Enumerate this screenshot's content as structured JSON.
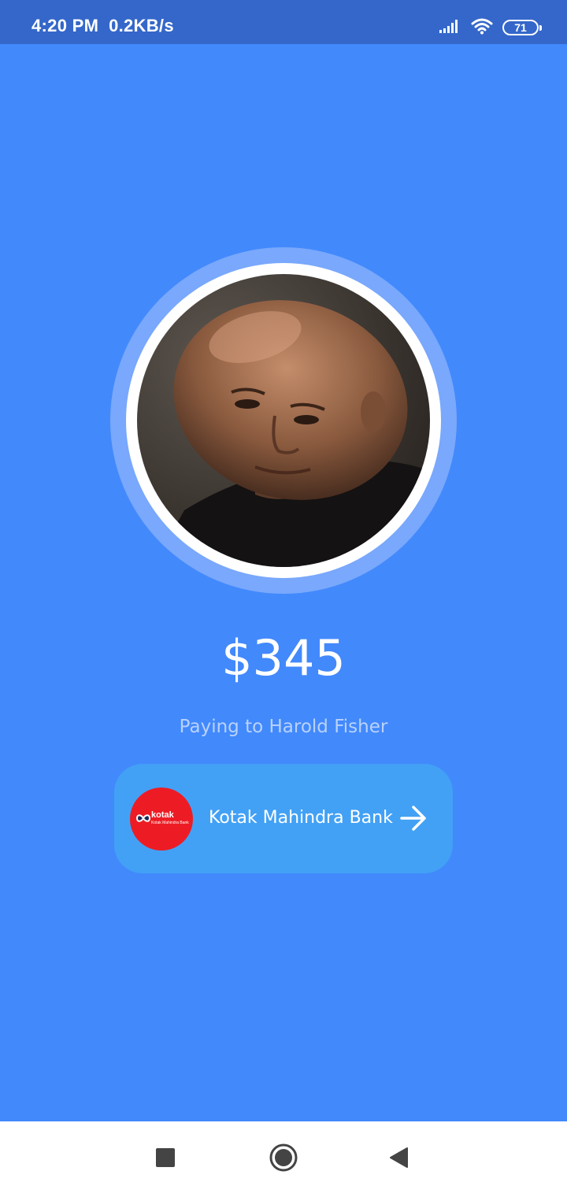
{
  "status_bar": {
    "time": "4:20 PM",
    "network_speed": "0.2KB/s",
    "battery_level": "71",
    "icons": [
      "signal-icon",
      "wifi-icon",
      "battery-icon"
    ]
  },
  "payment": {
    "amount": "$345",
    "paying_to": "Paying to Harold Fisher"
  },
  "bank": {
    "name": "Kotak Mahindra Bank",
    "logo_word": "kotak",
    "logo_sub": "Kotak Mahindra Bank",
    "logo_color": "#ed1c24"
  },
  "colors": {
    "background": "#4289fc",
    "status_bar": "#3467c9",
    "card": "#42a1f5",
    "avatar_halo": "#79a8fc"
  },
  "nav": {
    "buttons": [
      "recents-square-icon",
      "home-circle-icon",
      "back-triangle-icon"
    ]
  }
}
